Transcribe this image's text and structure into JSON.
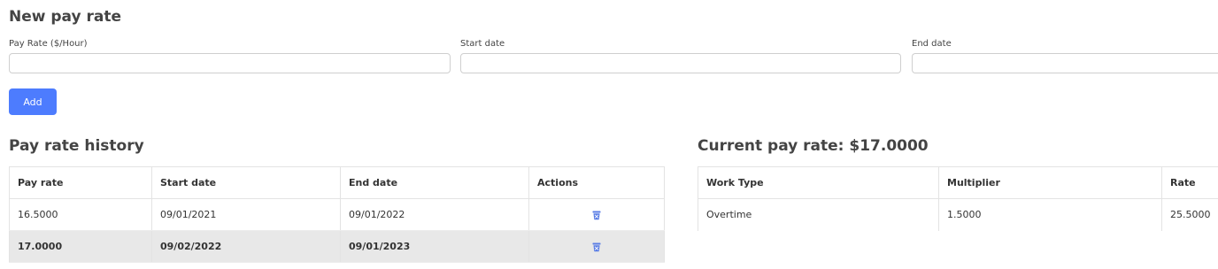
{
  "new_pay_rate": {
    "title": "New pay rate",
    "pay_rate_label": "Pay Rate ($/Hour)",
    "pay_rate_value": "",
    "start_date_label": "Start date",
    "start_date_value": "",
    "end_date_label": "End date",
    "end_date_value": "",
    "add_label": "Add"
  },
  "history": {
    "title": "Pay rate history",
    "columns": [
      "Pay rate",
      "Start date",
      "End date",
      "Actions"
    ],
    "rows": [
      {
        "pay_rate": "16.5000",
        "start_date": "09/01/2021",
        "end_date": "09/01/2022",
        "action_icon": "trash-icon"
      },
      {
        "pay_rate": "17.0000",
        "start_date": "09/02/2022",
        "end_date": "09/01/2023",
        "action_icon": "trash-icon",
        "current": true
      }
    ]
  },
  "current": {
    "title": "Current pay rate: $17.0000",
    "columns": [
      "Work Type",
      "Multiplier",
      "Rate"
    ],
    "rows": [
      {
        "work_type": "Overtime",
        "multiplier": "1.5000",
        "rate": "25.5000"
      }
    ]
  },
  "colors": {
    "accent": "#4d7cfe",
    "highlight_row": "#e8e8e8",
    "icon": "#5b7ee5"
  }
}
